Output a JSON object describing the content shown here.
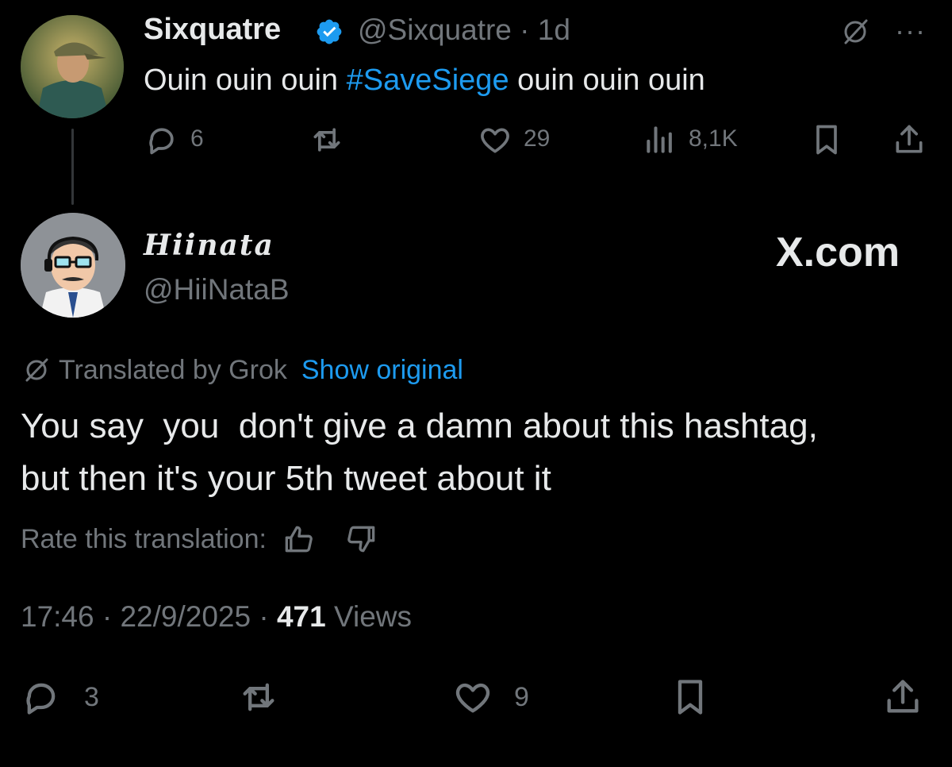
{
  "parent_tweet": {
    "display_name": "Sixquatre",
    "handle": "@Sixquatre",
    "separator": "·",
    "time_ago": "1d",
    "text_before": "Ouin ouin ouin ",
    "hashtag": "#SaveSiege",
    "text_after": " ouin ouin ouin",
    "replies": "6",
    "likes": "29",
    "views": "8,1K",
    "more_label": "···",
    "icons": [
      "verified-badge-icon",
      "grok-icon",
      "reply-icon",
      "retweet-icon",
      "like-icon",
      "views-icon",
      "bookmark-icon",
      "share-icon"
    ]
  },
  "reply_tweet": {
    "display_name": "Hiinata",
    "handle": "@HiiNataB",
    "watermark": "X.com",
    "translated_label": "Translated by Grok",
    "show_original": "Show original",
    "text_line1": "You say  you  don't give a damn about this hashtag,",
    "text_line2": "but then it's your 5th tweet about it",
    "rate_label": "Rate this translation:",
    "time": "17:46",
    "date": "22/9/2025",
    "separator": "·",
    "views_count": "471",
    "views_label": "Views",
    "replies": "3",
    "likes": "9"
  },
  "colors": {
    "background": "#000000",
    "text": "#e7e9ea",
    "muted": "#71767b",
    "accent": "#1d9bf0"
  }
}
